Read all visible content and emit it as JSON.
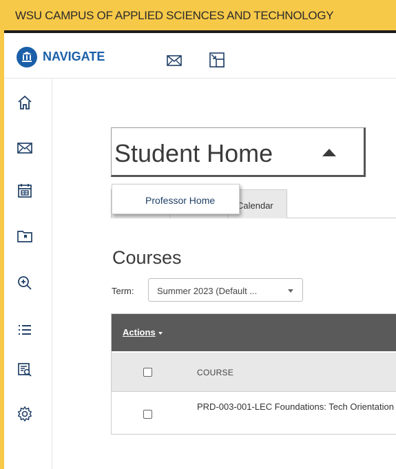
{
  "banner": {
    "title": "WSU CAMPUS OF APPLIED SCIENCES AND TECHNOLOGY"
  },
  "header": {
    "brand": "NAVIGATE",
    "icons": [
      "mail-icon",
      "switch-window-icon"
    ]
  },
  "sidebar": {
    "items": [
      {
        "icon": "home-icon"
      },
      {
        "icon": "mail-icon"
      },
      {
        "icon": "calendar-icon"
      },
      {
        "icon": "folder-icon"
      },
      {
        "icon": "search-zoom-icon"
      },
      {
        "icon": "list-icon"
      },
      {
        "icon": "report-search-icon"
      },
      {
        "icon": "settings-icon"
      }
    ]
  },
  "page": {
    "title": "Student Home",
    "dropdown_item": "Professor Home",
    "tabs": [
      {
        "label": ""
      },
      {
        "label": ""
      },
      {
        "label": "Calendar"
      }
    ]
  },
  "courses": {
    "heading": "Courses",
    "term_label": "Term:",
    "term_value": "Summer 2023 (Default ...",
    "actions_label": "Actions",
    "column_course": "COURSE",
    "rows": [
      {
        "course": "PRD-003-001-LEC Foundations: Tech Orientation"
      }
    ]
  },
  "colors": {
    "banner": "#f7c948",
    "brand": "#1a5fa8",
    "actions_bar": "#5a5a5a"
  }
}
